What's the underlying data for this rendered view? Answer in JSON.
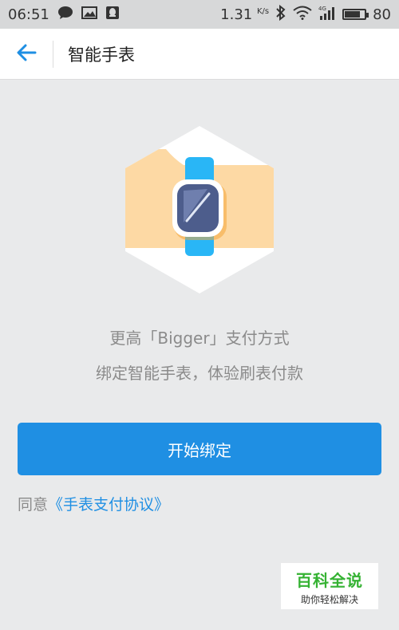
{
  "status_bar": {
    "time": "06:51",
    "net_speed": "1.31",
    "net_unit": "K/s",
    "network_type": "4G",
    "battery": "80",
    "battery_level": 0.8
  },
  "header": {
    "title": "智能手表"
  },
  "main": {
    "desc_line1": "更高「Bigger」支付方式",
    "desc_line2": "绑定智能手表，体验刷表付款",
    "bind_button_label": "开始绑定",
    "agree_prefix": "同意",
    "agreement_link": "《手表支付协议》"
  },
  "watermark": {
    "main": "百科全说",
    "sub": "助你轻松解决"
  },
  "colors": {
    "accent": "#1f8fe3",
    "watch_band": "#29b6f6",
    "arm": "#fdd9a4",
    "watermark_green": "#35b233"
  },
  "icons": [
    "chat-icon",
    "image-icon",
    "qq-icon",
    "bluetooth-icon",
    "wifi-icon",
    "signal-icon",
    "battery-icon",
    "back-arrow-icon"
  ]
}
